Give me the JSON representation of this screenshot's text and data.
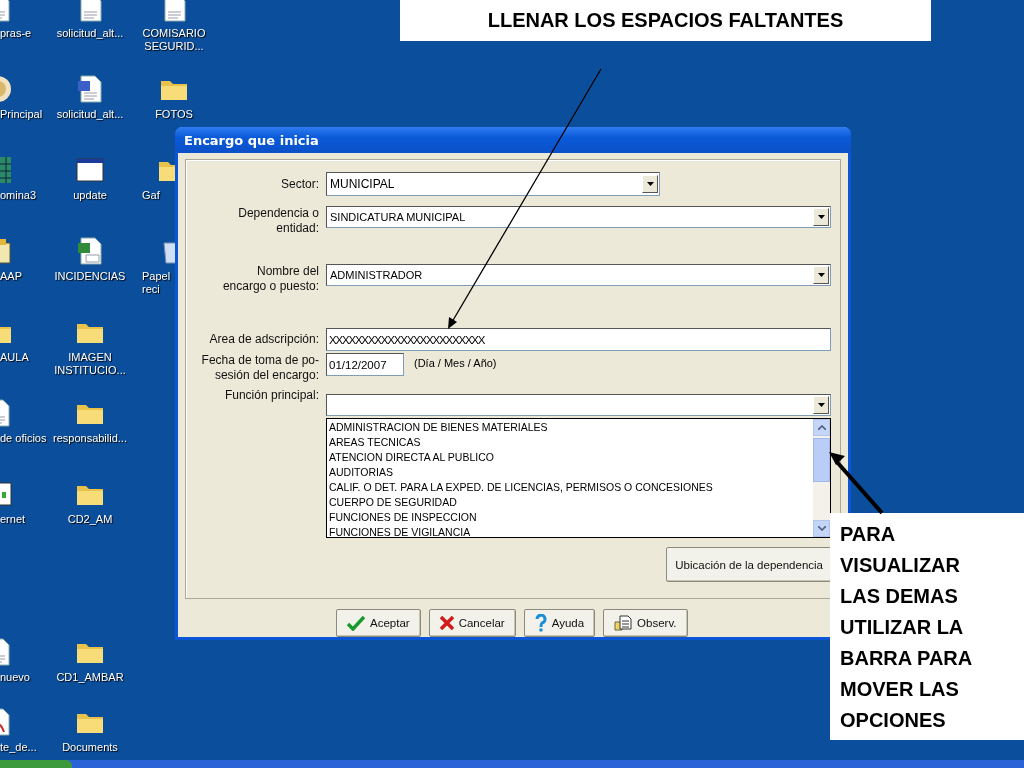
{
  "desktop": {
    "icons": [
      {
        "label": "pras-e",
        "kind": "doc"
      },
      {
        "label": "Principal",
        "kind": "emblem"
      },
      {
        "label": "omina3",
        "kind": "grid"
      },
      {
        "label": "AAP",
        "kind": "card"
      },
      {
        "label": "AULA",
        "kind": "folder"
      },
      {
        "label": "de oficios",
        "kind": "word"
      },
      {
        "label": "ernet",
        "kind": "browser"
      },
      {
        "label": "nuevo",
        "kind": "word"
      },
      {
        "label": "te_de...",
        "kind": "pdf"
      },
      {
        "label": "solicitud_alt...",
        "kind": "doc"
      },
      {
        "label": "solicitud_alt...",
        "kind": "word"
      },
      {
        "label": "update",
        "kind": "window"
      },
      {
        "label": "INCIDENCIAS",
        "kind": "excel"
      },
      {
        "label": "IMAGEN INSTITUCIO...",
        "kind": "folder"
      },
      {
        "label": "responsabilid...",
        "kind": "folder"
      },
      {
        "label": "CD2_AM",
        "kind": "folder"
      },
      {
        "label": "CD1_AMBAR",
        "kind": "folder"
      },
      {
        "label": "Documents",
        "kind": "folder"
      },
      {
        "label": "COMISARIO SEGURID...",
        "kind": "doc"
      },
      {
        "label": "FOTOS",
        "kind": "folder"
      },
      {
        "label": "Gaf",
        "kind": "folder"
      },
      {
        "label": "Papel reci",
        "kind": "recycle"
      }
    ]
  },
  "dialog": {
    "title": "Encargo que inicia",
    "fields": [
      {
        "kind": "dropdown",
        "label": "Sector:",
        "value": "MUNICIPAL"
      },
      {
        "kind": "dropdown",
        "label": "Dependencia o entidad:",
        "value": "SINDICATURA MUNICIPAL"
      },
      {
        "kind": "dropdown",
        "label": "Nombre del encargo o puesto:",
        "value": "ADMINISTRADOR"
      },
      {
        "kind": "text",
        "label": "Area de adscripción:",
        "value": "XXXXXXXXXXXXXXXXXXXXXXXX"
      },
      {
        "kind": "date",
        "label": "Fecha de toma de po-sesión del encargo:",
        "value": "01/12/2007",
        "hint": "(Día / Mes / Año)"
      },
      {
        "kind": "dropdown",
        "label": "Función principal:",
        "options": [
          "ADMINISTRACION DE BIENES MATERIALES",
          "AREAS TECNICAS",
          "ATENCION DIRECTA AL PUBLICO",
          "AUDITORIAS",
          "CALIF. O DET. PARA LA EXPED. DE LICENCIAS, PERMISOS O CONCESIONES",
          "CUERPO DE SEGURIDAD",
          "FUNCIONES DE INSPECCION",
          "FUNCIONES DE VIGILANCIA"
        ]
      }
    ],
    "side_button": "Ubicación de la dependencia",
    "buttons": [
      {
        "label": "Aceptar",
        "kind": "accept"
      },
      {
        "label": "Cancelar",
        "kind": "cancel"
      },
      {
        "label": "Ayuda",
        "kind": "help"
      },
      {
        "label": "Observ.",
        "kind": "notes"
      }
    ]
  },
  "annotations": [
    {
      "text": "LLENAR LOS ESPACIOS FALTANTES"
    },
    {
      "text": "PARA VISUALIZAR LAS DEMAS UTILIZAR LA BARRA PARA MOVER LAS OPCIONES"
    }
  ]
}
